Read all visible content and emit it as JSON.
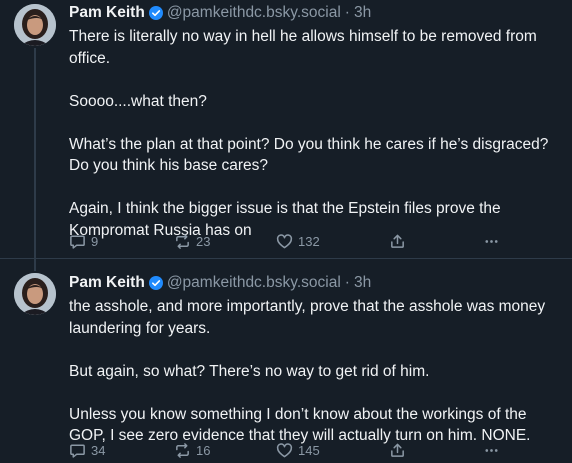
{
  "posts": [
    {
      "author_name": "Pam Keith",
      "handle": "@pamkeithdc.bsky.social",
      "separator": "·",
      "time": "3h",
      "paragraphs": [
        "There is literally no way in hell he allows himself to be removed from office.",
        "Soooo....what then?",
        "What’s the plan at that point? Do you think he cares if he’s disgraced? Do you think his base cares?",
        "Again, I think the bigger issue is that the Epstein files prove the Kompromat Russia has on"
      ],
      "replies": "9",
      "reposts": "23",
      "likes": "132"
    },
    {
      "author_name": "Pam Keith",
      "handle": "@pamkeithdc.bsky.social",
      "separator": "·",
      "time": "3h",
      "paragraphs": [
        "the asshole, and more importantly, prove that the asshole was money laundering for years.",
        "But again, so what?  There’s no way to get rid of him.",
        "Unless you know something I don’t know about the workings of the GOP, I see zero evidence that they will actually turn on him.  NONE."
      ],
      "replies": "34",
      "reposts": "16",
      "likes": "145"
    }
  ],
  "colors": {
    "background": "#161e27",
    "text": "#f1f3f5",
    "muted": "#8b98a5",
    "verified": "#208bfe",
    "divider": "#2e3b49"
  },
  "icons": [
    "verified-badge-icon",
    "reply-icon",
    "repost-icon",
    "like-icon",
    "share-icon",
    "more-icon"
  ]
}
